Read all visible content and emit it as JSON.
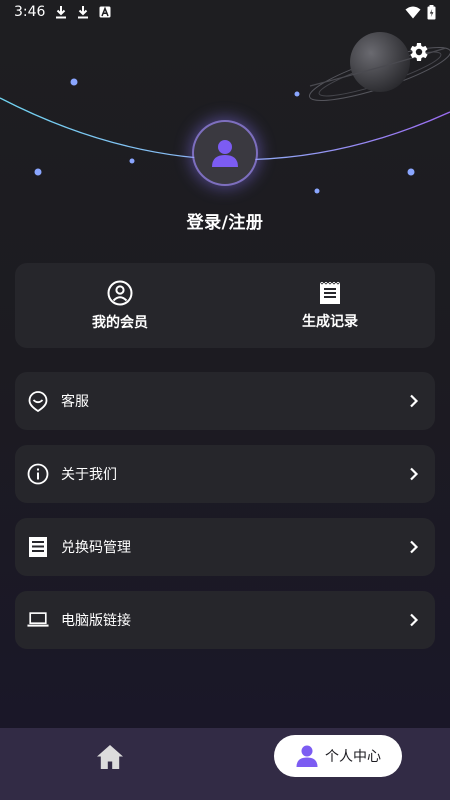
{
  "status_bar": {
    "time": "3:46",
    "icons": [
      "download-icon",
      "download-icon",
      "a-letter-icon",
      "wifi-icon",
      "battery-icon"
    ]
  },
  "header": {
    "settings_icon": "gear-icon"
  },
  "profile": {
    "avatar_icon": "user-icon",
    "login_label": "登录/注册"
  },
  "quick_actions": [
    {
      "label": "我的会员",
      "icon": "member-icon"
    },
    {
      "label": "生成记录",
      "icon": "record-icon"
    }
  ],
  "menu": [
    {
      "label": "客服",
      "icon": "service-icon"
    },
    {
      "label": "关于我们",
      "icon": "info-icon"
    },
    {
      "label": "兑换码管理",
      "icon": "coupon-icon"
    },
    {
      "label": "电脑版链接",
      "icon": "laptop-icon"
    }
  ],
  "bottom_nav": {
    "home_icon": "home-icon",
    "profile_label": "个人中心",
    "profile_icon": "user-icon"
  },
  "colors": {
    "background": "#1c1b20",
    "card": "#26262b",
    "accent": "#7c5cf2",
    "nav_bg": "#322b45"
  }
}
